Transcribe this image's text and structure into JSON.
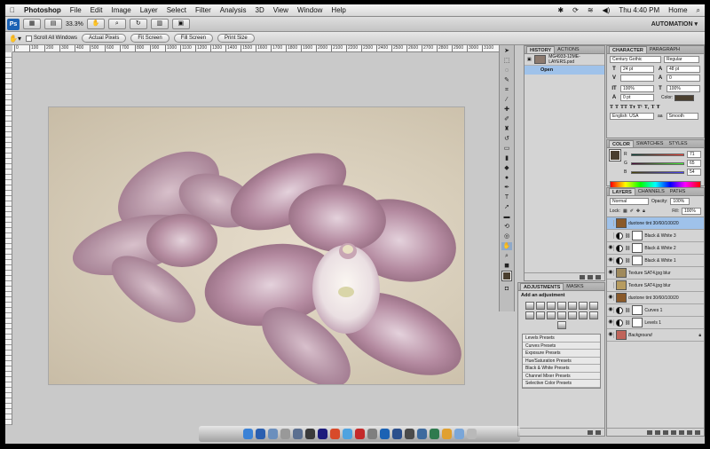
{
  "menubar": {
    "apple": "",
    "items": [
      "Photoshop",
      "File",
      "Edit",
      "Image",
      "Layer",
      "Select",
      "Filter",
      "Analysis",
      "3D",
      "View",
      "Window",
      "Help"
    ],
    "clock": "Thu 4:40 PM",
    "user": "Home"
  },
  "appbar": {
    "logo": "Ps",
    "zoom": "33.3%",
    "workspace": "AUTOMATION ▾"
  },
  "options": {
    "scroll_all_label": "Scroll All Windows",
    "buttons": [
      "Actual Pixels",
      "Fit Screen",
      "Fill Screen",
      "Print Size"
    ]
  },
  "ruler": {
    "ticks": [
      "0",
      "100",
      "200",
      "300",
      "400",
      "500",
      "600",
      "700",
      "800",
      "900",
      "1000",
      "1100",
      "1200",
      "1300",
      "1400",
      "1500",
      "1600",
      "1700",
      "1800",
      "1900",
      "2000",
      "2100",
      "2200",
      "2300",
      "2400",
      "2500",
      "2600",
      "2700",
      "2800",
      "2900",
      "3000",
      "3100"
    ]
  },
  "history": {
    "tabs": [
      "HISTORY",
      "ACTIONS"
    ],
    "snapshot": "MG4933-12ME- LAYERS.psd",
    "state": "Open"
  },
  "adjustments": {
    "tabs": [
      "ADJUSTMENTS",
      "MASKS"
    ],
    "add_label": "Add an adjustment",
    "presets": [
      "Levels Presets",
      "Curves Presets",
      "Exposure Presets",
      "Hue/Saturation Presets",
      "Black & White Presets",
      "Channel Mixer Presets",
      "Selective Color Presets"
    ]
  },
  "character": {
    "tabs": [
      "CHARACTER",
      "PARAGRAPH"
    ],
    "font": "Century Gothic",
    "style": "Regular",
    "size": "24 pt",
    "leading": "48 pt",
    "kerning": "",
    "tracking": "0",
    "vscale": "100%",
    "hscale": "100%",
    "baseline": "0 pt",
    "color_label": "Color:",
    "language": "English: USA",
    "antialias": "Smooth",
    "color_hex": "#4a3f2f"
  },
  "color": {
    "tabs": [
      "COLOR",
      "SWATCHES",
      "STYLES"
    ],
    "r_label": "R",
    "g_label": "G",
    "b_label": "B",
    "r": "71",
    "g": "65",
    "b": "54"
  },
  "layers": {
    "tabs": [
      "LAYERS",
      "CHANNELS",
      "PATHS"
    ],
    "blend": "Normal",
    "opacity_label": "Opacity:",
    "opacity": "100%",
    "lock_label": "Lock:",
    "fill_label": "Fill:",
    "fill": "100%",
    "list": [
      {
        "name": "duotone tint 30/60/100/20",
        "selected": true,
        "thumb": "#8a5a2a",
        "mask": false,
        "visible": false
      },
      {
        "name": "Black & White 3",
        "selected": false,
        "thumb": "",
        "mask": true,
        "visible": false
      },
      {
        "name": "Black & White 2",
        "selected": false,
        "thumb": "",
        "mask": true,
        "visible": true
      },
      {
        "name": "Black & White 1",
        "selected": false,
        "thumb": "",
        "mask": true,
        "visible": true
      },
      {
        "name": "Texture SAT4.jpg blur",
        "selected": false,
        "thumb": "#a08a5c",
        "mask": false,
        "visible": true
      },
      {
        "name": "Texture SAT4.jpg blur",
        "selected": false,
        "thumb": "#b79c60",
        "mask": false,
        "visible": false
      },
      {
        "name": "duotone tint 30/60/100/20",
        "selected": false,
        "thumb": "#8a5a2a",
        "mask": false,
        "visible": true
      },
      {
        "name": "Curves 1",
        "selected": false,
        "thumb": "",
        "mask": true,
        "visible": true
      },
      {
        "name": "Levels 1",
        "selected": false,
        "thumb": "",
        "mask": true,
        "visible": true
      },
      {
        "name": "Background",
        "selected": false,
        "thumb": "#c0645a",
        "mask": false,
        "visible": true
      }
    ]
  }
}
